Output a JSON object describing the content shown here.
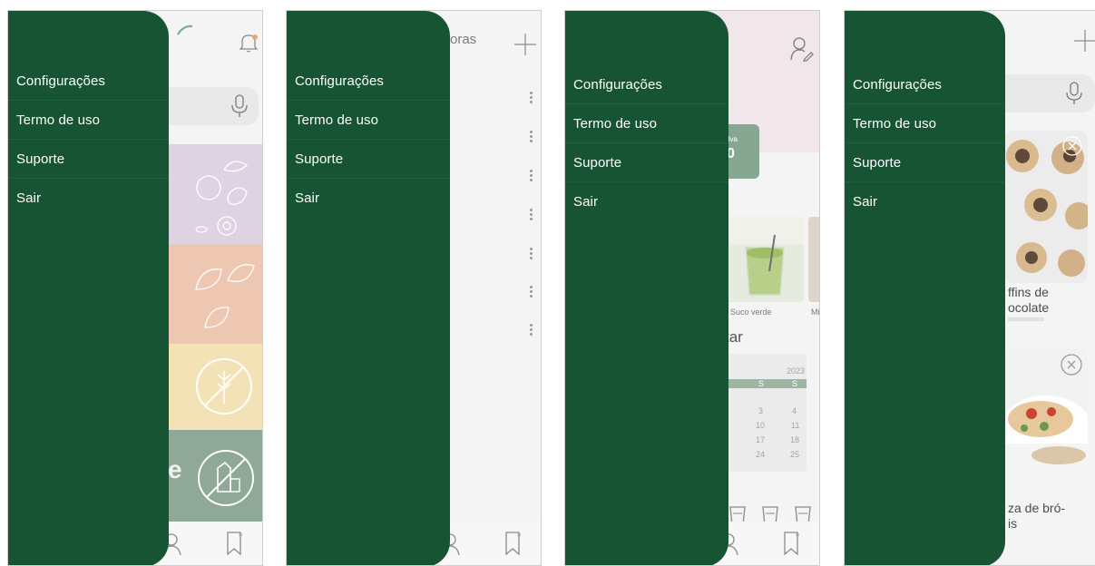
{
  "menu": {
    "items": [
      {
        "label": "Configurações"
      },
      {
        "label": "Termo de uso"
      },
      {
        "label": "Suporte"
      },
      {
        "label": "Sair"
      }
    ]
  },
  "screen2": {
    "partial_header": "oras"
  },
  "screen3": {
    "badge_text": "ilva",
    "badge_value": "0",
    "photo_label": "Suco verde",
    "photo_label2": "Mi",
    "section_title": "tar",
    "calendar": {
      "year": "2023",
      "weekdays": [
        "S",
        "S"
      ],
      "rows": [
        [
          "3",
          "4"
        ],
        [
          "10",
          "11"
        ],
        [
          "17",
          "18"
        ],
        [
          "24",
          "25"
        ]
      ]
    }
  },
  "screen4": {
    "recipes": [
      {
        "title": "ffins de\nocolate"
      },
      {
        "title": "za de bró-\nis"
      }
    ]
  },
  "colors": {
    "drawer": "#175434",
    "lilac": "#ddd3e2",
    "peach": "#eec7b2",
    "yellow": "#f3e2b6",
    "sage": "#8fa897"
  }
}
